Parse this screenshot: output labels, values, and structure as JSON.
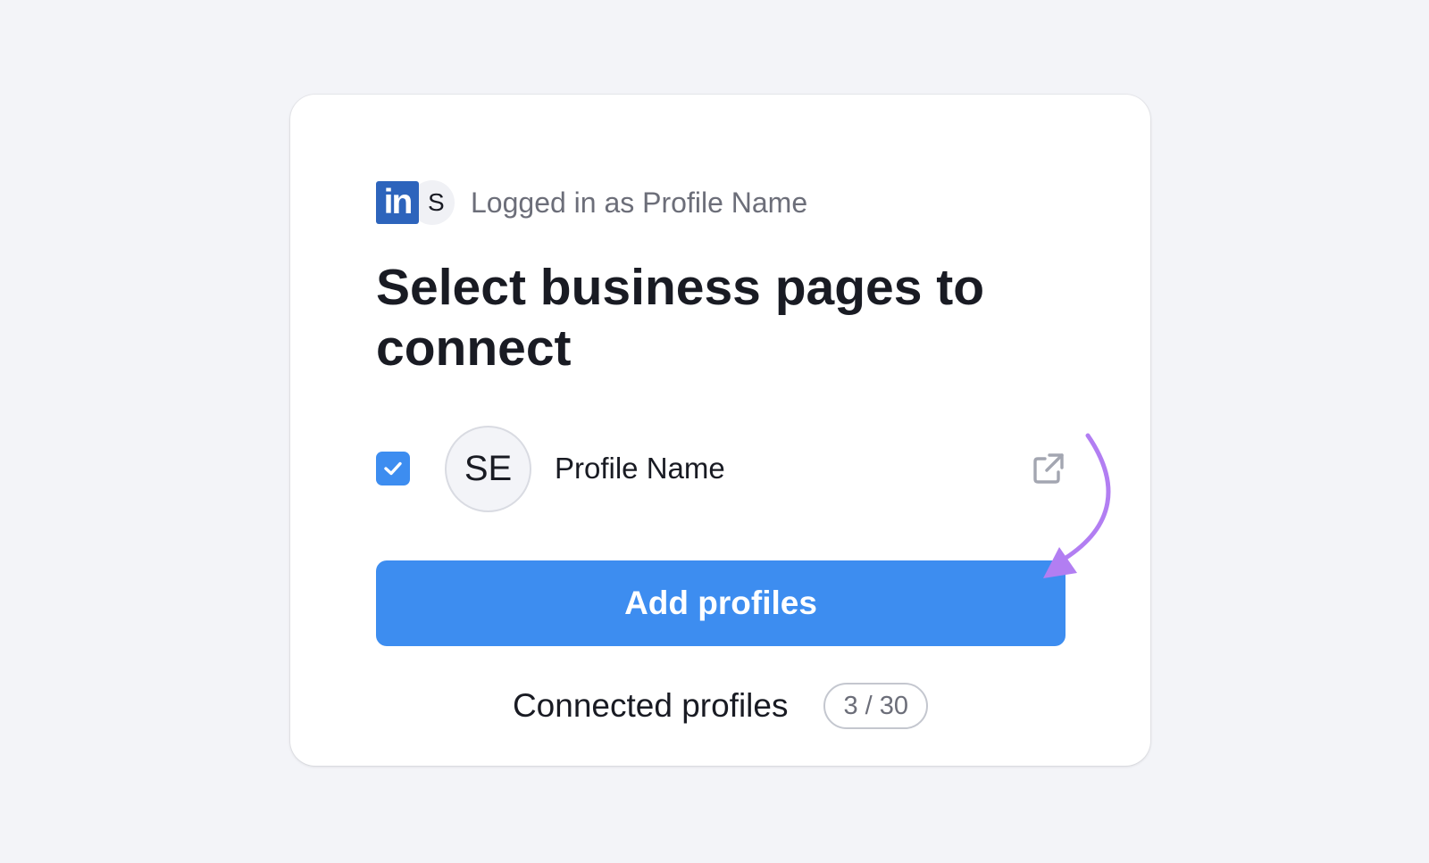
{
  "header": {
    "linkedin_logo_text": "in",
    "account_avatar_letter": "S",
    "logged_in_text": "Logged in as Profile Name"
  },
  "title": "Select business pages to connect",
  "profile": {
    "selected": true,
    "avatar_initials": "SE",
    "name": "Profile Name",
    "link_icon": "external-link-icon"
  },
  "actions": {
    "add_label": "Add profiles"
  },
  "connected": {
    "label": "Connected profiles",
    "count": "3 / 30"
  },
  "colors": {
    "background": "#f3f4f8",
    "primary": "#3d8df0",
    "linkedin": "#2d64bc",
    "annotation_arrow": "#b27ef2",
    "text": "#191b23",
    "muted_text": "#6c6e79"
  }
}
